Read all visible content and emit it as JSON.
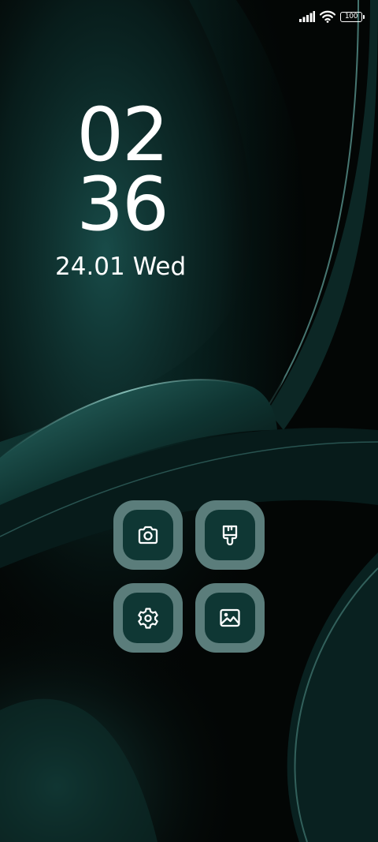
{
  "status_bar": {
    "battery_level": "100",
    "icons": [
      "signal-icon",
      "wifi-icon",
      "battery-icon"
    ]
  },
  "clock": {
    "hours": "02",
    "minutes": "36",
    "date": "24.01 Wed"
  },
  "apps": [
    {
      "id": "camera",
      "icon": "camera-icon"
    },
    {
      "id": "theme",
      "icon": "paint-brush-icon"
    },
    {
      "id": "settings",
      "icon": "gear-icon"
    },
    {
      "id": "gallery",
      "icon": "image-icon"
    }
  ],
  "colors": {
    "background": "#030605",
    "wallpaper_accent": "#1d5c58",
    "tile_outer": "#5b7d7b",
    "tile_inner": "#0f3734",
    "text": "#ffffff"
  }
}
